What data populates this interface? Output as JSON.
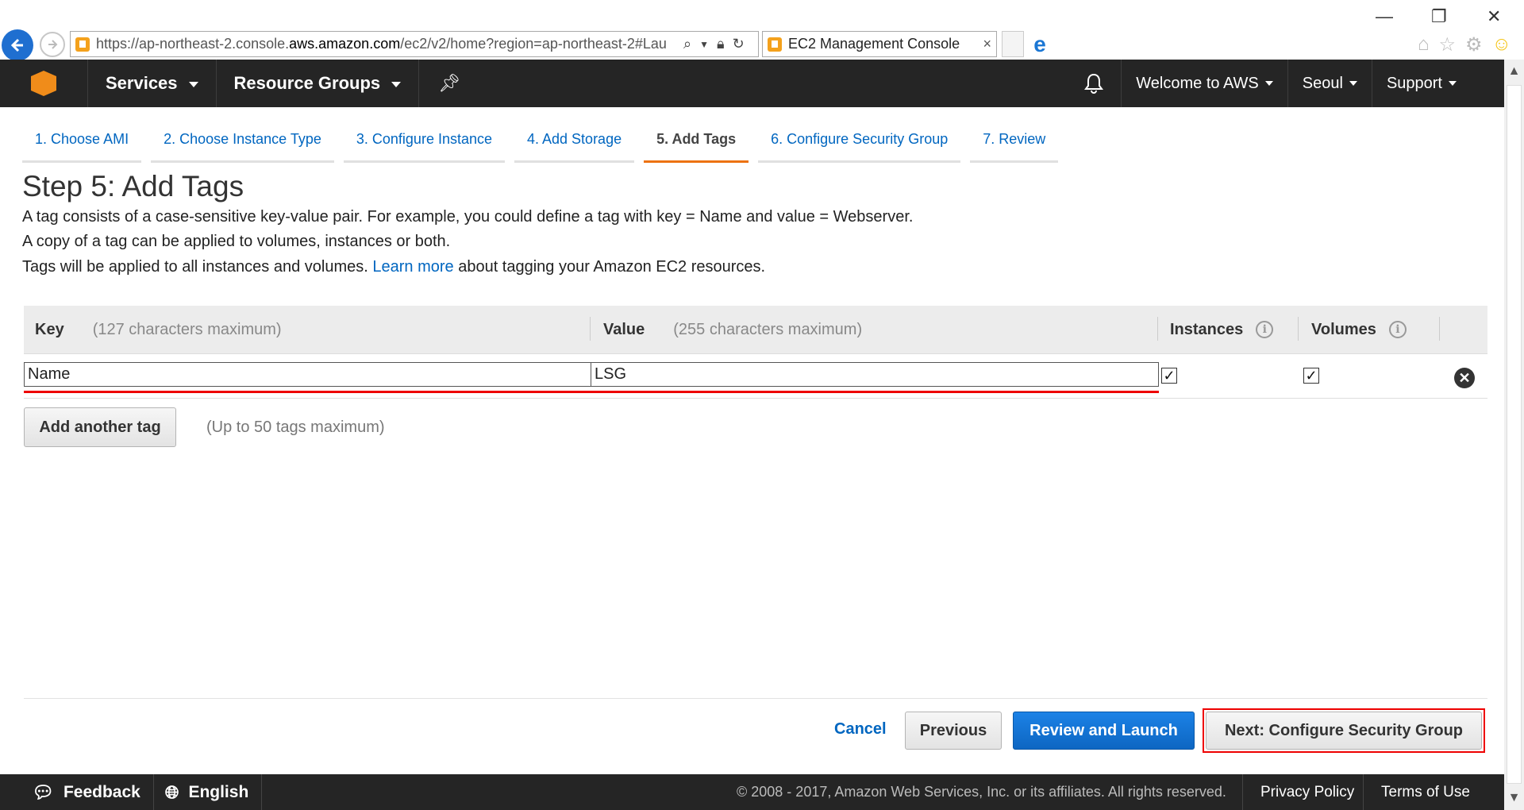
{
  "browser": {
    "url_prefix": "https://ap-northeast-2.console.",
    "url_domain": "aws.amazon.com",
    "url_suffix": "/ec2/v2/home?region=ap-northeast-2#Lau",
    "tab_title": "EC2 Management Console",
    "tab_close": "×"
  },
  "awsnav": {
    "services": "Services",
    "resource_groups": "Resource Groups",
    "welcome": "Welcome to AWS",
    "region": "Seoul",
    "support": "Support"
  },
  "steps": [
    {
      "label": "1. Choose AMI"
    },
    {
      "label": "2. Choose Instance Type"
    },
    {
      "label": "3. Configure Instance"
    },
    {
      "label": "4. Add Storage"
    },
    {
      "label": "5. Add Tags",
      "active": true
    },
    {
      "label": "6. Configure Security Group"
    },
    {
      "label": "7. Review"
    }
  ],
  "page": {
    "title": "Step 5: Add Tags",
    "desc1": "A tag consists of a case-sensitive key-value pair. For example, you could define a tag with key = Name and value = Webserver.",
    "desc2": "A copy of a tag can be applied to volumes, instances or both.",
    "desc3_pre": "Tags will be applied to all instances and volumes. ",
    "desc3_link": "Learn more",
    "desc3_post": " about tagging your Amazon EC2 resources."
  },
  "table": {
    "key_header": "Key",
    "key_hint": "(127 characters maximum)",
    "value_header": "Value",
    "value_hint": "(255 characters maximum)",
    "instances_header": "Instances",
    "volumes_header": "Volumes",
    "info_glyph": "i",
    "rows": [
      {
        "key": "Name",
        "value": "LSG",
        "instances": true,
        "volumes": true
      }
    ],
    "check_glyph": "✓"
  },
  "actions": {
    "add_tag": "Add another tag",
    "add_tag_hint": "(Up to 50 tags maximum)",
    "cancel": "Cancel",
    "previous": "Previous",
    "review_launch": "Review and Launch",
    "next": "Next: Configure Security Group"
  },
  "footer": {
    "feedback": "Feedback",
    "english": "English",
    "copyright": "© 2008 - 2017, Amazon Web Services, Inc. or its affiliates. All rights reserved.",
    "privacy": "Privacy Policy",
    "terms": "Terms of Use"
  },
  "colors": {
    "accent": "#ec7211",
    "link": "#0066c0",
    "primary_button": "#0d66c2",
    "highlight": "#ee0000"
  }
}
